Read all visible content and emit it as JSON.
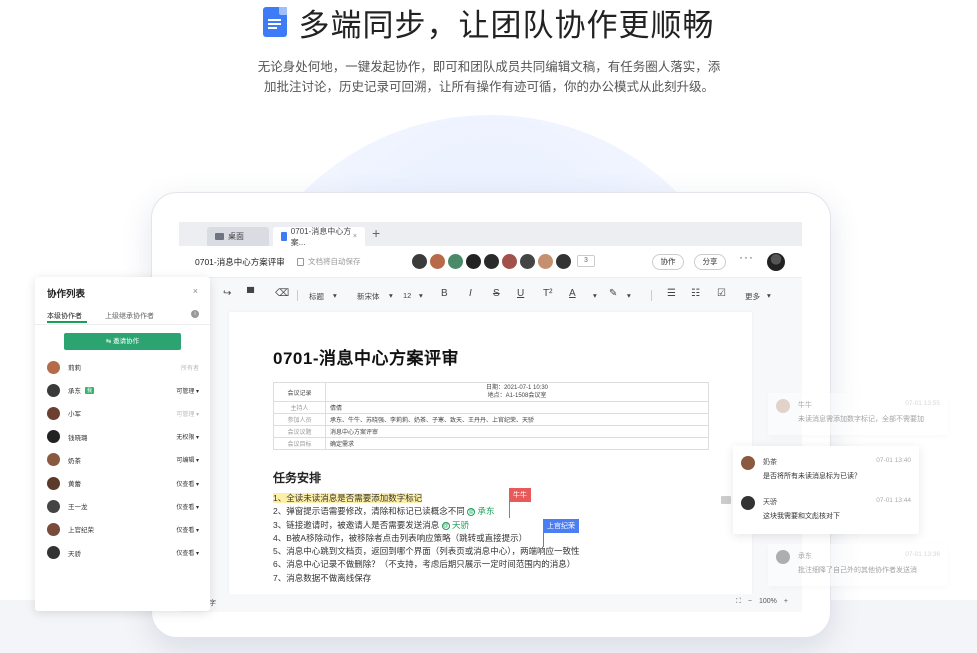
{
  "hero": {
    "title": "多端同步，让团队协作更顺畅",
    "subtitle_line1": "无论身处何地，一键发起协作，即可和团队成员共同编辑文稿，有任务圈人落实，添",
    "subtitle_line2": "加批注讨论，历史记录可回溯，让所有操作有迹可循，你的办公模式从此刻升级。"
  },
  "tabs": [
    {
      "label": "桌面"
    },
    {
      "label": "0701-消息中心方案...",
      "close": "×"
    }
  ],
  "header": {
    "doc_name": "0701-消息中心方案评审",
    "autosave": "文档将自动保存",
    "avatar_count": "3",
    "collab_label": "协作",
    "share_label": "分享",
    "more": "···"
  },
  "toolbar": {
    "style": "标题",
    "font": "新宋体",
    "size": "12",
    "bold": "B",
    "italic": "I",
    "strike": "S",
    "underline": "U",
    "more": "更多"
  },
  "doc": {
    "title": "0701-消息中心方案评审",
    "table": {
      "col1_header": "会议记录",
      "header_line1": "日期：2021-07-1 10:30",
      "header_line2": "地点：A1-1508会议室",
      "rows": [
        {
          "label": "主持人",
          "value": "倩倩"
        },
        {
          "label": "参加人员",
          "value": "承东、牛牛、苏晓强、李莉莉、奶茶、子寒、致天、王丹丹、上官纪荣、天骄"
        },
        {
          "label": "会议议题",
          "value": "消息中心方案评审"
        },
        {
          "label": "会议目标",
          "value": "确定需求"
        }
      ]
    },
    "section_title": "任务安排",
    "tasks": [
      "1、全读未读消息是否需要添加数字标记",
      "2、弹窗提示语需要修改，清除和标记已读概念不同",
      "3、链接邀请时，被邀请人是否需要发送消息",
      "4、B被A移除动作，被移除者点击列表响应策略（跳转或直接提示）",
      "5、消息中心跳到文档页，返回到哪个界面（列表页或消息中心），两端响应一致性",
      "6、消息中心记录不做删除？（不支持，考虑后期只展示一定时间范围内的消息）",
      "7、消息数据不做离线保存"
    ],
    "mention1": "承东",
    "mention2": "天骄",
    "cursor1": "牛牛",
    "cursor2": "上官纪荣",
    "mention_at": "@"
  },
  "status": {
    "word_count": "字",
    "zoom": "100%",
    "fit": "⛶",
    "minus": "−",
    "plus": "+"
  },
  "panel": {
    "title": "协作列表",
    "close": "×",
    "tab1": "本级协作者",
    "tab2": "上级继承协作者",
    "info": "i",
    "invite": "⇆ 邀请协作",
    "members": [
      {
        "name": "莉莉",
        "perm": "所有者",
        "badge": "",
        "color": "#b36b4a"
      },
      {
        "name": "承东",
        "perm": "可管理 ▾",
        "badge": "我",
        "color": "#3a3a3a"
      },
      {
        "name": "小军",
        "perm": "可管理 ▾",
        "badge": "",
        "color": "#6b4030"
      },
      {
        "name": "钱晓璐",
        "perm": "无权限 ▾",
        "badge": "",
        "color": "#222222"
      },
      {
        "name": "奶茶",
        "perm": "可编辑 ▾",
        "badge": "",
        "color": "#8a5a40"
      },
      {
        "name": "黄蕾",
        "perm": "仅查看 ▾",
        "badge": "",
        "color": "#5a3a2a"
      },
      {
        "name": "王一龙",
        "perm": "仅查看 ▾",
        "badge": "",
        "color": "#444444"
      },
      {
        "name": "上官纪荣",
        "perm": "仅查看 ▾",
        "badge": "",
        "color": "#7a4a3a"
      },
      {
        "name": "天骄",
        "perm": "仅查看 ▾",
        "badge": "",
        "color": "#333333"
      }
    ]
  },
  "comments": [
    {
      "name": "牛牛",
      "time": "07-01 13:55",
      "text": "未读消息需添加数字标记，全部不需要加"
    },
    {
      "name": "奶茶",
      "time": "07-01 13:40",
      "text": "是否将所有未读消息标为已读？"
    },
    {
      "name": "天骄",
      "time": "07-01 13:44",
      "text": "这块我需要和文彪核对下"
    },
    {
      "name": "承东",
      "time": "07-01 13:36",
      "text": "批注细降了自己外的其他协作者发送消"
    }
  ],
  "colors": {
    "accent": "#3d7cf6",
    "green": "#2ba471",
    "cursor_red": "#e85a5a",
    "cursor_blue": "#4c7ef3"
  }
}
